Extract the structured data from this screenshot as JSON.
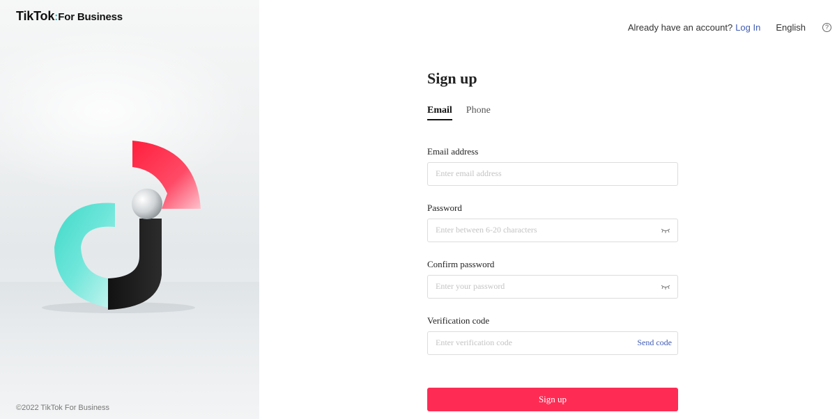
{
  "brand": {
    "name": "TikTok",
    "separator": ":",
    "suffix": "For Business"
  },
  "footer": {
    "copyright": "©2022 TikTok For Business"
  },
  "topbar": {
    "account_prompt": "Already have an account?",
    "login_link": "Log In",
    "language": "English",
    "help_icon": "?"
  },
  "form": {
    "title": "Sign up",
    "tabs": [
      {
        "label": "Email",
        "active": true
      },
      {
        "label": "Phone",
        "active": false
      }
    ],
    "email": {
      "label": "Email address",
      "placeholder": "Enter email address"
    },
    "password": {
      "label": "Password",
      "placeholder": "Enter between 6-20 characters"
    },
    "confirm_password": {
      "label": "Confirm password",
      "placeholder": "Enter your password"
    },
    "verification": {
      "label": "Verification code",
      "placeholder": "Enter verification code",
      "send_code": "Send code"
    },
    "submit_label": "Sign up"
  },
  "colors": {
    "accent": "#fe2c55",
    "link": "#3f5bb5",
    "brand_red": "#ff2d55",
    "brand_cyan": "#25c4c0"
  },
  "icons": {
    "password_toggle": "eye-closed-icon",
    "help": "question-circle-icon"
  }
}
